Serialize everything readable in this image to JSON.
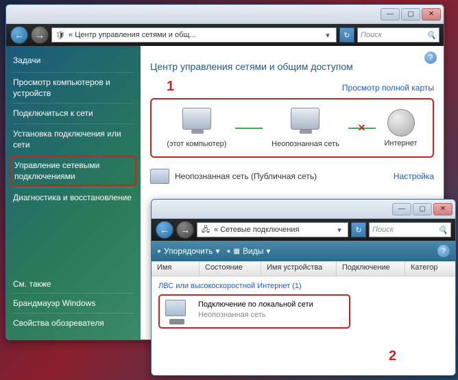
{
  "window1": {
    "addressPrefix": "«",
    "addressText": "Центр управления сетями и общ...",
    "searchPlaceholder": "Поиск",
    "title": "Центр управления сетями и общим доступом",
    "mapLink": "Просмотр полной карты",
    "nodeThis": "(этот компьютер)",
    "nodeUnknown": "Неопознанная сеть",
    "nodeInternet": "Интернет",
    "netRowLabel": "Неопознанная сеть (Публичная сеть)",
    "netRowConfig": "Настройка",
    "sidebar": {
      "tasksHeading": "Задачи",
      "items": [
        "Просмотр компьютеров и устройств",
        "Подключиться к сети",
        "Установка подключения или сети",
        "Управление сетевыми подключениями",
        "Диагностика и восстановление"
      ],
      "seeAlso": "См. также",
      "bottom": [
        "Брандмауэр Windows",
        "Свойства обозревателя"
      ]
    }
  },
  "window2": {
    "addressPrefix": "«",
    "addressText": "Сетевые подключения",
    "searchPlaceholder": "Поиск",
    "toolbar": {
      "organize": "Упорядочить",
      "views": "Виды"
    },
    "columns": [
      "Имя",
      "Состояние",
      "Имя устройства",
      "Подключение",
      "Категор"
    ],
    "groupLabel": "ЛВС или высокоскоростной Интернет (1)",
    "conn": {
      "name": "Подключение по локальной сети",
      "status": "Неопознанная сеть"
    }
  },
  "markers": {
    "one": "1",
    "two": "2"
  }
}
